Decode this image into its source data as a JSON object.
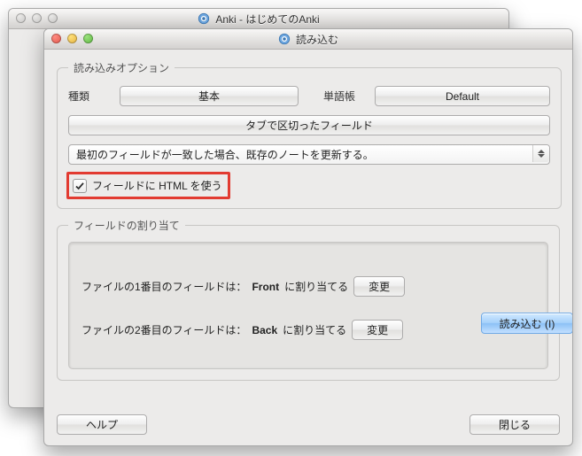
{
  "windows": {
    "main": {
      "title": "Anki - はじめてのAnki"
    },
    "import": {
      "title": "読み込む"
    }
  },
  "import": {
    "options_group": "読み込みオプション",
    "type_label": "種類",
    "type_value": "基本",
    "deck_label": "単語帳",
    "deck_value": "Default",
    "delimiter_button": "タブで区切ったフィールド",
    "mode_selected": "最初のフィールドが一致した場合、既存のノートを更新する。",
    "allow_html_label": "フィールドに HTML を使う",
    "allow_html_checked": true,
    "mapping_group": "フィールドの割り当て",
    "mappings": [
      {
        "prefix": "ファイルの1番目のフィールドは：",
        "field": "Front",
        "suffix": "に割り当てる"
      },
      {
        "prefix": "ファイルの2番目のフィールドは：",
        "field": "Back",
        "suffix": "に割り当てる"
      }
    ],
    "change_button": "変更",
    "import_button": "読み込む (I)",
    "help_button": "ヘルプ",
    "close_button": "閉じる"
  }
}
